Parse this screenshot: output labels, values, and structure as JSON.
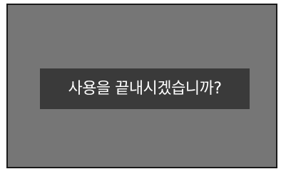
{
  "dialog": {
    "message": "사용을 끝내시겠습니까?"
  },
  "colors": {
    "screen_background": "#767676",
    "screen_border": "#1a1a1a",
    "dialog_background": "#3a3a3a",
    "dialog_text": "#ffffff"
  }
}
